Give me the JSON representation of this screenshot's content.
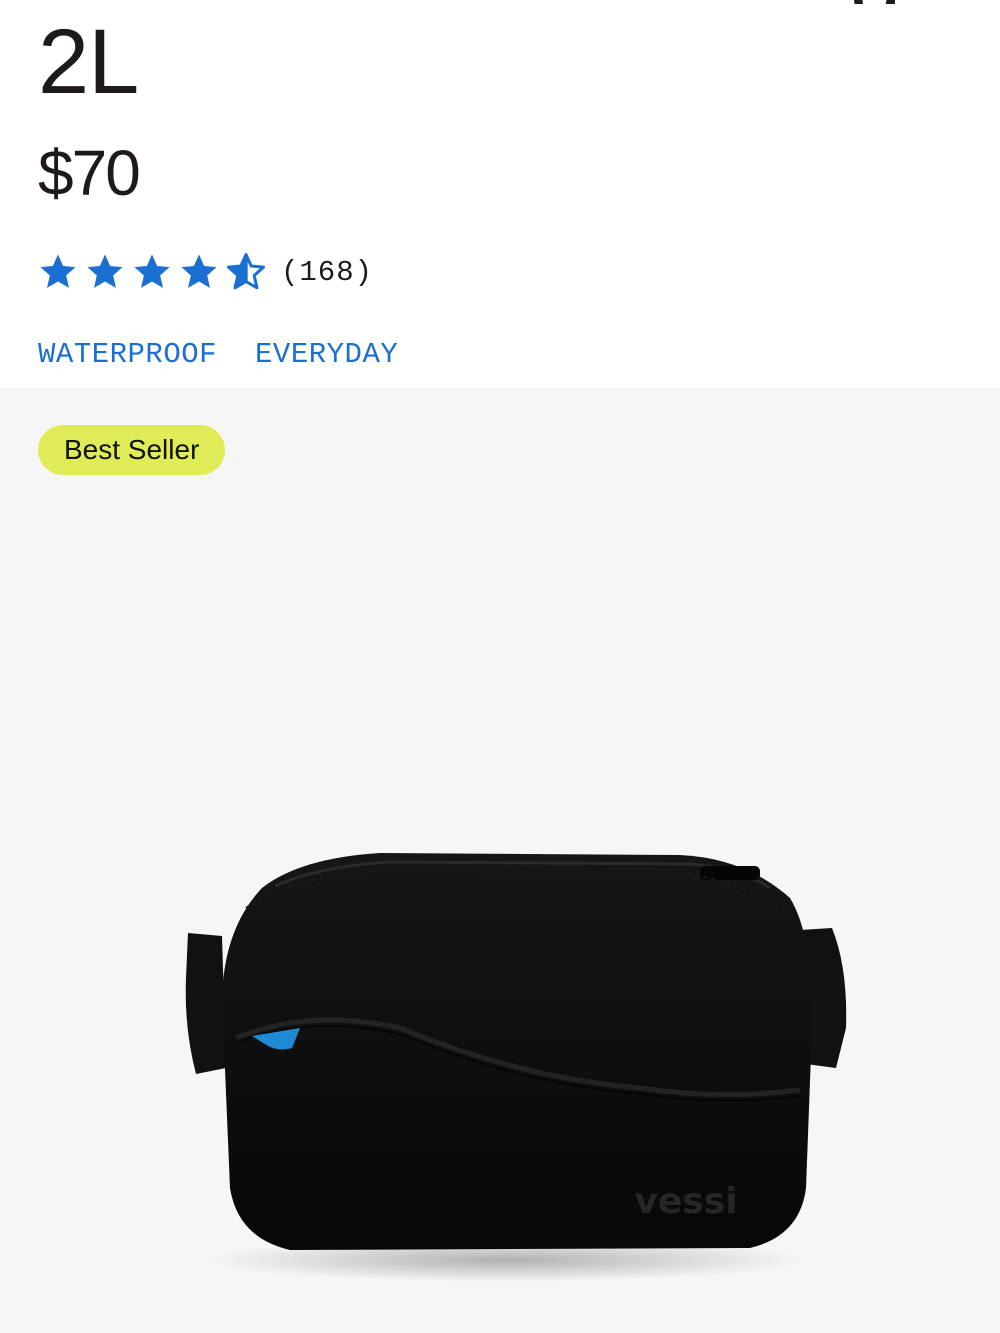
{
  "product": {
    "title_fragment": "g",
    "title_line": "2L",
    "price": "$70",
    "rating": {
      "stars": 4.5,
      "star_max": 5,
      "star_color": "#1a6fd1",
      "review_count": "(168)"
    },
    "tags": [
      "WATERPROOF",
      "EVERYDAY"
    ],
    "tag_color": "#1a6fd1",
    "badge": {
      "label": "Best Seller",
      "color": "#dfec58"
    },
    "image": {
      "brand_mark": "vessi",
      "bag_color": "#0b0b0b",
      "accent_color": "#1e8bd4",
      "background_color": "#f6f6f6"
    }
  }
}
